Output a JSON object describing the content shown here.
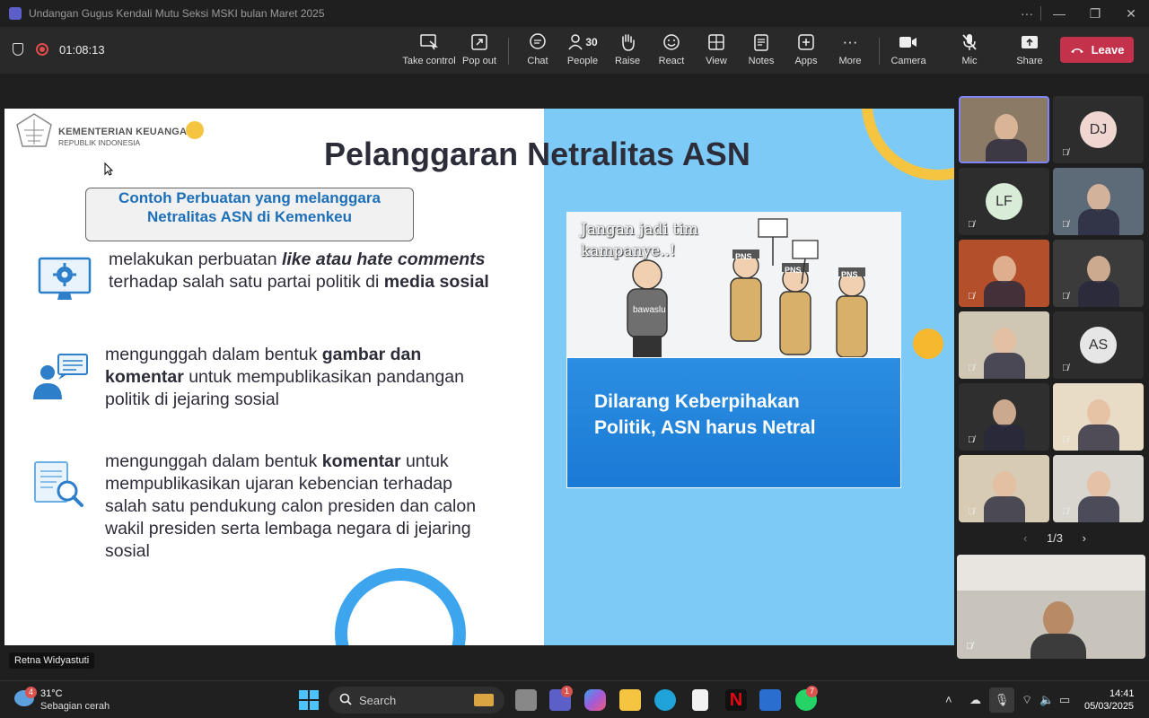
{
  "window": {
    "title": "Undangan Gugus Kendali Mutu Seksi MSKI bulan Maret 2025"
  },
  "meeting": {
    "timer": "01:08:13",
    "toolbar": [
      {
        "label": "Take control",
        "icon": "take-control-icon"
      },
      {
        "label": "Pop out",
        "icon": "pop-out-icon"
      },
      {
        "label": "Chat",
        "icon": "chat-icon"
      },
      {
        "label": "People",
        "icon": "people-icon",
        "count": "30"
      },
      {
        "label": "Raise",
        "icon": "raise-hand-icon"
      },
      {
        "label": "React",
        "icon": "react-icon"
      },
      {
        "label": "View",
        "icon": "view-icon"
      },
      {
        "label": "Notes",
        "icon": "notes-icon"
      },
      {
        "label": "Apps",
        "icon": "apps-icon"
      },
      {
        "label": "More",
        "icon": "more-icon"
      },
      {
        "label": "Camera",
        "icon": "camera-icon"
      },
      {
        "label": "Mic",
        "icon": "mic-off-icon"
      },
      {
        "label": "Share",
        "icon": "share-icon"
      }
    ],
    "leave_label": "Leave",
    "presenter_name": "Retna Widyastuti",
    "pager": "1/3"
  },
  "slide": {
    "logo_line1": "KEMENTERIAN KEUANGAN",
    "logo_line2": "REPUBLIK INDONESIA",
    "title": "Pelanggaran Netralitas ASN",
    "box_title": "Contoh Perbuatan yang melanggara Netralitas ASN di Kemenkeu",
    "items": [
      {
        "icon": "computer-settings-icon",
        "parts": [
          "melakukan perbuatan ",
          "like atau hate comments",
          " terhadap salah satu partai politik di ",
          "media sosial"
        ]
      },
      {
        "icon": "person-comment-icon",
        "parts": [
          "mengunggah dalam bentuk ",
          "gambar dan komentar",
          " untuk mempublikasikan pandangan politik di jejaring sosial"
        ]
      },
      {
        "icon": "document-search-icon",
        "parts": [
          "mengunggah dalam bentuk ",
          "komentar",
          " untuk mempublikasikan ujaran kebencian terhadap salah satu pendukung calon presiden dan calon wakil presiden serta lembaga negara di jejaring sosial"
        ]
      }
    ],
    "cartoon_caption": "Jangan jadi tim kampanye..!",
    "cartoon_signs": [
      "PNS",
      "PNS",
      "PNS",
      "bawaslu"
    ],
    "panel_text": "Dilarang Keberpihakan Politik, ASN harus Netral"
  },
  "participants": [
    {
      "name": "video",
      "initials": "",
      "muted": false,
      "bg": "#8a7a66"
    },
    {
      "name": "avatar",
      "initials": "DJ",
      "muted": true,
      "bg": "#efd6d0"
    },
    {
      "name": "avatar",
      "initials": "LF",
      "muted": true,
      "bg": "#d8ecd8"
    },
    {
      "name": "video",
      "initials": "",
      "muted": true,
      "bg": "#5d6a78"
    },
    {
      "name": "video",
      "initials": "",
      "muted": true,
      "bg": "#b34f2a"
    },
    {
      "name": "photo",
      "initials": "",
      "muted": true,
      "bg": "#3b3b3b"
    },
    {
      "name": "video",
      "initials": "",
      "muted": true,
      "bg": "#cfc7b4"
    },
    {
      "name": "avatar",
      "initials": "AS",
      "muted": true,
      "bg": "#e6e6e6"
    },
    {
      "name": "photo",
      "initials": "",
      "muted": true,
      "bg": "#2f2f2f"
    },
    {
      "name": "video",
      "initials": "",
      "muted": true,
      "bg": "#e9dcc6"
    },
    {
      "name": "video",
      "initials": "",
      "muted": true,
      "bg": "#d7cbb4"
    },
    {
      "name": "video",
      "initials": "",
      "muted": true,
      "bg": "#d9d6d0"
    }
  ],
  "taskbar": {
    "temperature": "31°C",
    "weather": "Sebagian cerah",
    "weather_badge": "4",
    "search_label": "Search",
    "teams_badge": "1",
    "whatsapp_badge": "7",
    "time": "14:41",
    "date": "05/03/2025"
  },
  "colors": {
    "leave": "#c4314b",
    "accent": "#7f85f5",
    "slide_blue": "#7dcaf7",
    "panel_blue": "#1a7ad6",
    "yellow": "#f5c542"
  }
}
